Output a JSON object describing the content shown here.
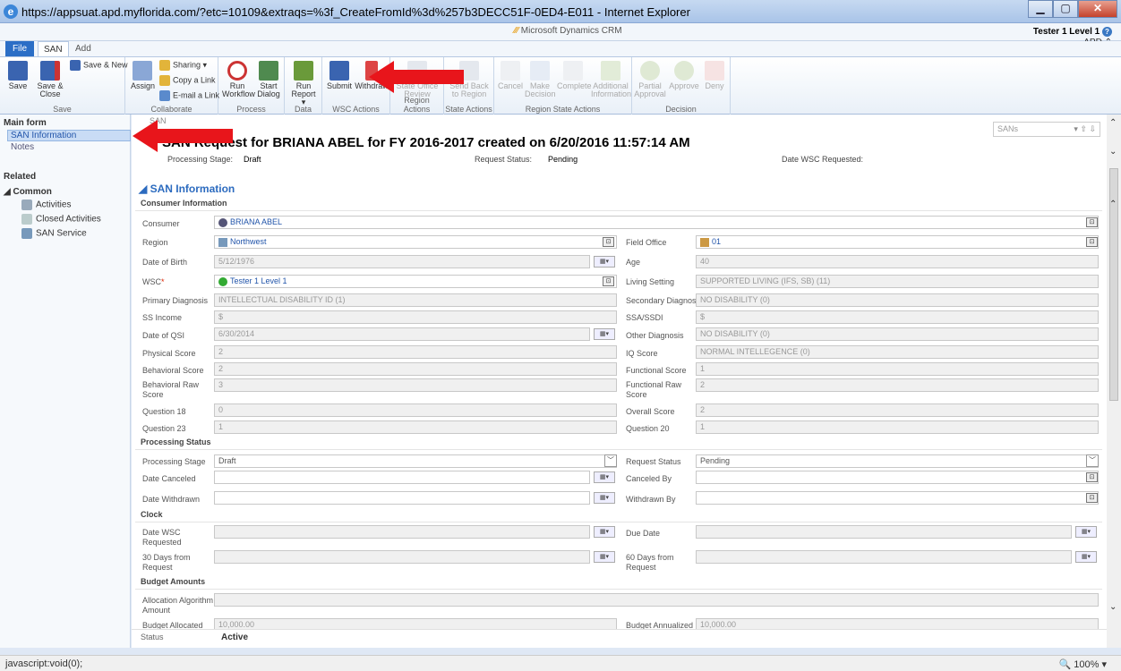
{
  "browser": {
    "url": "https://appsuat.apd.myflorida.com/?etc=10109&extraqs=%3f_CreateFromId%3d%257b3DECC51F-0ED4-E011 - Internet Explorer",
    "status": "javascript:void(0);",
    "zoom": "100%"
  },
  "app": {
    "product": "Microsoft Dynamics CRM",
    "user": "Tester 1 Level 1",
    "org": "APD"
  },
  "tabs": {
    "file": "File",
    "san": "SAN",
    "add": "Add"
  },
  "ribbon": {
    "save": "Save",
    "save_close": "Save & Close",
    "save_new": "Save & New",
    "save_group": "Save",
    "assign": "Assign",
    "sharing": "Sharing",
    "copy_link": "Copy a Link",
    "email_link": "E-mail a Link",
    "collab_group": "Collaborate",
    "run_workflow": "Run Workflow",
    "start_dialog": "Start Dialog",
    "process_group": "Process",
    "run_report": "Run Report",
    "data_group": "Data",
    "submit": "Submit",
    "withdraw": "Withdraw",
    "wsc_group": "WSC Actions",
    "state_office_review": "State Office Review",
    "region_group": "Region Actions",
    "send_back": "Send Back to Region",
    "state_group": "State Actions",
    "cancel": "Cancel",
    "make_decision": "Make Decision",
    "complete": "Complete",
    "additional_info": "Additional Information",
    "region_state_group": "Region State Actions",
    "partial_approval": "Partial Approval",
    "approve": "Approve",
    "deny": "Deny",
    "decision_group": "Decision"
  },
  "nav": {
    "main_form": "Main form",
    "san_info": "SAN Information",
    "notes": "Notes",
    "related": "Related",
    "common": "Common",
    "activities": "Activities",
    "closed_activities": "Closed Activities",
    "san_service": "SAN Service"
  },
  "header": {
    "entity": "SAN",
    "title": "SAN Request for BRIANA ABEL for FY 2016-2017 created on 6/20/2016 11:57:14 AM",
    "processing_stage_label": "Processing Stage:",
    "processing_stage": "Draft",
    "request_status_label": "Request Status:",
    "request_status": "Pending",
    "date_wsc_label": "Date WSC Requested:",
    "record_selector": "SANs"
  },
  "form": {
    "section": "SAN Information",
    "consumer_info": "Consumer Information",
    "consumer_label": "Consumer",
    "consumer": "BRIANA ABEL",
    "region_label": "Region",
    "region": "Northwest",
    "field_office_label": "Field Office",
    "field_office": "01",
    "dob_label": "Date of Birth",
    "dob": "5/12/1976",
    "age_label": "Age",
    "age": "40",
    "wsc_label": "WSC",
    "wsc": "Tester 1 Level 1",
    "living_label": "Living Setting",
    "living": "SUPPORTED LIVING (IFS, SB) (11)",
    "primary_dx_label": "Primary Diagnosis",
    "primary_dx": "INTELLECTUAL DISABILITY ID (1)",
    "secondary_dx_label": "Secondary Diagnosis",
    "secondary_dx": "NO DISABILITY (0)",
    "ss_income_label": "SS Income",
    "ss_income": "$",
    "ssa_label": "SSA/SSDI",
    "ssa": "$",
    "qsi_date_label": "Date of QSI",
    "qsi_date": "6/30/2014",
    "other_dx_label": "Other Diagnosis",
    "other_dx": "NO DISABILITY (0)",
    "physical_label": "Physical Score",
    "physical": "2",
    "iq_label": "IQ Score",
    "iq": "NORMAL INTELLEGENCE (0)",
    "behavioral_label": "Behavioral Score",
    "behavioral": "2",
    "functional_label": "Functional Score",
    "functional": "1",
    "beh_raw_label": "Behavioral Raw Score",
    "beh_raw": "3",
    "func_raw_label": "Functional Raw Score",
    "func_raw": "2",
    "q18_label": "Question 18",
    "q18": "0",
    "overall_label": "Overall Score",
    "overall": "2",
    "q23_label": "Question 23",
    "q23": "1",
    "q20_label": "Question 20",
    "q20": "1",
    "processing_status": "Processing Status",
    "stage_label": "Processing Stage",
    "stage": "Draft",
    "req_status_label": "Request Status",
    "req_status": "Pending",
    "date_canceled_label": "Date Canceled",
    "canceled_by_label": "Canceled By",
    "date_withdrawn_label": "Date Withdrawn",
    "withdrawn_by_label": "Withdrawn By",
    "clock": "Clock",
    "date_wsc_label": "Date WSC Requested",
    "due_date_label": "Due Date",
    "days30_label": "30 Days from Request",
    "days60_label": "60 Days from Request",
    "budget_amounts": "Budget Amounts",
    "alloc_algo_label": "Allocation Algorithm Amount",
    "budget_alloc_label": "Budget Allocated",
    "budget_alloc": "10,000.00",
    "budget_annual_label": "Budget Annualized",
    "budget_annual": "10,000.00"
  },
  "footer": {
    "status_label": "Status",
    "status": "Active"
  }
}
